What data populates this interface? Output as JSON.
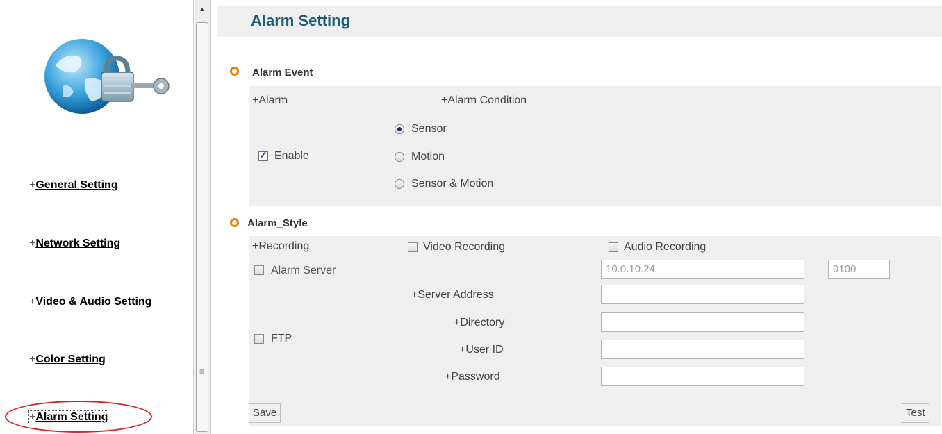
{
  "sidebar": {
    "logo_icon": "globe-lock-key-icon",
    "items": [
      {
        "plus": "+",
        "label": "General Setting"
      },
      {
        "plus": "+",
        "label": "Network Setting"
      },
      {
        "plus": "+",
        "label": "Video & Audio Setting"
      },
      {
        "plus": "+",
        "label": "Color Setting"
      },
      {
        "plus": "+",
        "label": "Alarm Setting",
        "active": true
      }
    ],
    "highlight_color": "#d9212b"
  },
  "page": {
    "title": "Alarm Setting"
  },
  "alarm_event": {
    "title": "Alarm Event",
    "alarm_header": "+Alarm",
    "condition_header": "+Alarm Condition",
    "enable_label": "Enable",
    "enable_checked": true,
    "conditions": [
      {
        "label": "Sensor",
        "selected": true
      },
      {
        "label": "Motion",
        "selected": false
      },
      {
        "label": "Sensor & Motion",
        "selected": false
      }
    ]
  },
  "alarm_style": {
    "title": "Alarm_Style",
    "recording_label": "+Recording",
    "video_recording_label": "Video Recording",
    "audio_recording_label": "Audio Recording",
    "alarm_server_label": "Alarm Server",
    "alarm_server_ip": "10.0.10.24",
    "alarm_server_port": "9100",
    "ftp_label": "FTP",
    "server_address_label": "+Server Address",
    "directory_label": "+Directory",
    "user_id_label": "+User ID",
    "password_label": "+Password",
    "server_address_value": "",
    "directory_value": "",
    "user_id_value": "",
    "password_value": "",
    "save_label": "Save",
    "test_label": "Test"
  },
  "colors": {
    "title": "#1b5a78",
    "bullet": "#f07c00",
    "panel": "#efefef"
  }
}
